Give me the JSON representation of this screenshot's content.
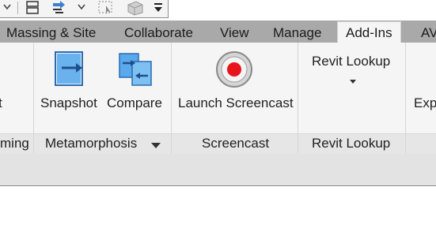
{
  "tabs": [
    {
      "label": "Massing & Site",
      "active": false
    },
    {
      "label": "Collaborate",
      "active": false
    },
    {
      "label": "View",
      "active": false
    },
    {
      "label": "Manage",
      "active": false
    },
    {
      "label": "Add-Ins",
      "active": true
    },
    {
      "label": "AV",
      "active": false
    }
  ],
  "panels": {
    "left_cut": {
      "button_fragment": "t",
      "title_fragment": "ming"
    },
    "metamorphosis": {
      "title": "Metamorphosis",
      "buttons": [
        {
          "label": "Snapshot",
          "icon": "snapshot-icon"
        },
        {
          "label": "Compare",
          "icon": "compare-icon"
        }
      ]
    },
    "screencast": {
      "title": "Screencast",
      "buttons": [
        {
          "label": "Launch Screencast",
          "icon": "record-icon"
        }
      ]
    },
    "revit_lookup": {
      "title": "Revit Lookup",
      "buttons": [
        {
          "label": "Revit Lookup",
          "icon": "dropdown-arrow-icon"
        }
      ]
    },
    "right_cut": {
      "button_fragment": "Exp"
    }
  },
  "colors": {
    "tab_bar": "#a9a9a9",
    "ribbon": "#f5f5f5",
    "icon_blue": "#4a9fe0",
    "record_red": "#e8141c"
  }
}
